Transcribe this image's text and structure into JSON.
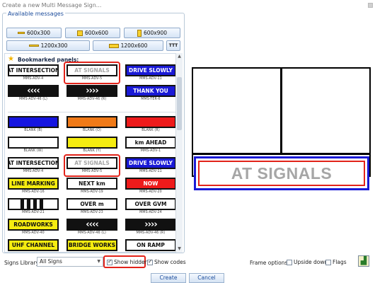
{
  "window": {
    "title": "Create a new Multi Message Sign..."
  },
  "available": {
    "label": "Available messages",
    "sizes": [
      "600x300",
      "600x600",
      "600x900",
      "1200x300",
      "1200x600"
    ],
    "tile_icon": "TTT"
  },
  "bookmarked": {
    "header": "Bookmarked panels:",
    "cells": [
      {
        "text": "AT INTERSECTION",
        "caption": "MMS-ADV-4",
        "bg": "#ffffff",
        "fg": "#111111"
      },
      {
        "text": "AT SIGNALS",
        "caption": "MMS-ADV-5",
        "bg": "#ffffff",
        "fg": "#a6a6a6"
      },
      {
        "text": "DRIVE SLOWLY",
        "caption": "MMS-ADV-11",
        "bg": "#1a1ad6",
        "fg": "#ffffff"
      },
      {
        "text": "‹‹‹‹",
        "caption": "MMS-ADV-46 (L)",
        "bg": "#111111",
        "fg": "#ffffff"
      },
      {
        "text": "››››",
        "caption": "MMS-ADV-46 (R)",
        "bg": "#111111",
        "fg": "#ffffff"
      },
      {
        "text": "THANK YOU",
        "caption": "MMS-TER-6",
        "bg": "#1a1ad6",
        "fg": "#ffffff"
      }
    ]
  },
  "all_signs": {
    "cells": [
      {
        "text": "",
        "caption": "BLANK (B)",
        "bg": "#1515e0",
        "fg": "#ffffff"
      },
      {
        "text": "",
        "caption": "BLANK (O)",
        "bg": "#f07a18",
        "fg": "#ffffff"
      },
      {
        "text": "",
        "caption": "BLANK (R)",
        "bg": "#ee1b1b",
        "fg": "#ffffff"
      },
      {
        "text": "",
        "caption": "BLANK (W)",
        "bg": "#ffffff",
        "fg": "#111111"
      },
      {
        "text": "",
        "caption": "BLANK (Y)",
        "bg": "#f5ec10",
        "fg": "#111111"
      },
      {
        "text": "km AHEAD",
        "caption": "MMS-ADV-1",
        "bg": "#ffffff",
        "fg": "#111111"
      },
      {
        "text": "AT INTERSECTION",
        "caption": "MMS-ADV-4",
        "bg": "#ffffff",
        "fg": "#111111"
      },
      {
        "text": "AT SIGNALS",
        "caption": "MMS-ADV-5",
        "bg": "#ffffff",
        "fg": "#a6a6a6"
      },
      {
        "text": "DRIVE SLOWLY",
        "caption": "MMS-ADV-11",
        "bg": "#1a1ad6",
        "fg": "#ffffff"
      },
      {
        "text": "LINE MARKING",
        "caption": "MMS-ADV-16",
        "bg": "#f5ec10",
        "fg": "#111111"
      },
      {
        "text": "NEXT km",
        "caption": "MMS-ADV-19",
        "bg": "#ffffff",
        "fg": "#111111"
      },
      {
        "text": "NOW",
        "caption": "MMS-ADV-20",
        "bg": "#ee1b1b",
        "fg": "#ffffff"
      },
      {
        "text": "▌▌▌▌",
        "caption": "MMS-ADV-21",
        "bg": "#ffffff",
        "fg": "#111111"
      },
      {
        "text": "OVER m",
        "caption": "MMS-ADV-23",
        "bg": "#ffffff",
        "fg": "#111111"
      },
      {
        "text": "OVER GVM",
        "caption": "MMS-ADV-24",
        "bg": "#ffffff",
        "fg": "#111111"
      },
      {
        "text": "ROADWORKS",
        "caption": "MMS-ADV-40",
        "bg": "#f5ec10",
        "fg": "#111111"
      },
      {
        "text": "‹‹‹‹",
        "caption": "MMS-ADV-46 (L)",
        "bg": "#111111",
        "fg": "#ffffff"
      },
      {
        "text": "››››",
        "caption": "MMS-ADV-46 (R)",
        "bg": "#111111",
        "fg": "#ffffff"
      },
      {
        "text": "UHF CHANNEL",
        "caption": "",
        "bg": "#f5ec10",
        "fg": "#111111"
      },
      {
        "text": "BRIDGE WORKS",
        "caption": "",
        "bg": "#f5ec10",
        "fg": "#111111"
      },
      {
        "text": "ON RAMP",
        "caption": "",
        "bg": "#ffffff",
        "fg": "#111111"
      }
    ]
  },
  "library": {
    "label": "Signs Library:",
    "value": "All Signs"
  },
  "options": {
    "show_hidden": "Show hidden",
    "show_codes": "Show codes"
  },
  "preview": {
    "sign_text": "AT SIGNALS"
  },
  "frame_options": {
    "label": "Frame options:",
    "upside_down": "Upside down",
    "flags": "Flags"
  },
  "buttons": {
    "create": "Create",
    "cancel": "Cancel"
  },
  "colors": {
    "selection": "#e2231a",
    "accent": "#1a4b9b",
    "frame_blue": "#1a1ad6"
  }
}
